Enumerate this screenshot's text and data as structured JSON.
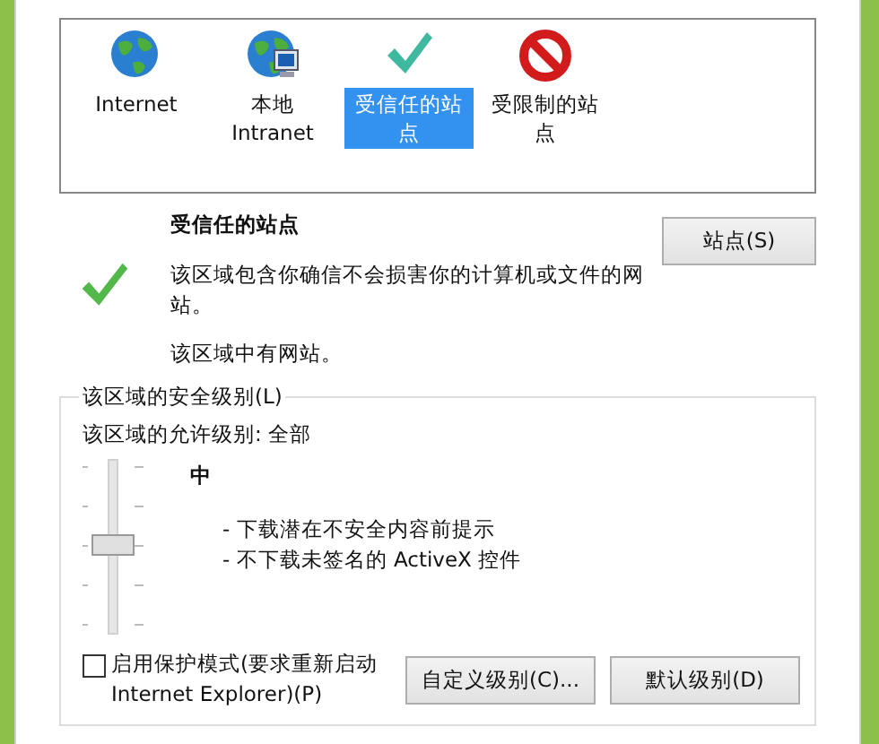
{
  "zones": [
    {
      "label": "Internet",
      "kind": "globe",
      "selected": false
    },
    {
      "label": "本地 Intranet",
      "kind": "intranet",
      "selected": false
    },
    {
      "label": "受信任的站点",
      "kind": "trusted",
      "selected": true
    },
    {
      "label": "受限制的站点",
      "kind": "restricted",
      "selected": false
    }
  ],
  "zone_info": {
    "title": "受信任的站点",
    "description": "该区域包含你确信不会损害你的计算机或文件的网站。",
    "status": "该区域中有网站。",
    "sites_button": "站点(S)"
  },
  "security_level": {
    "legend": "该区域的安全级别(L)",
    "allowed": "该区域的允许级别: 全部",
    "level": 0.5,
    "level_name": "中",
    "bullets": [
      "- 下载潜在不安全内容前提示",
      "- 不下载未签名的 ActiveX 控件"
    ]
  },
  "protected_mode": {
    "label": "启用保护模式(要求重新启动 Internet Explorer)(P)",
    "checked": false
  },
  "buttons": [
    "自定义级别(C)...",
    "默认级别(D)"
  ]
}
